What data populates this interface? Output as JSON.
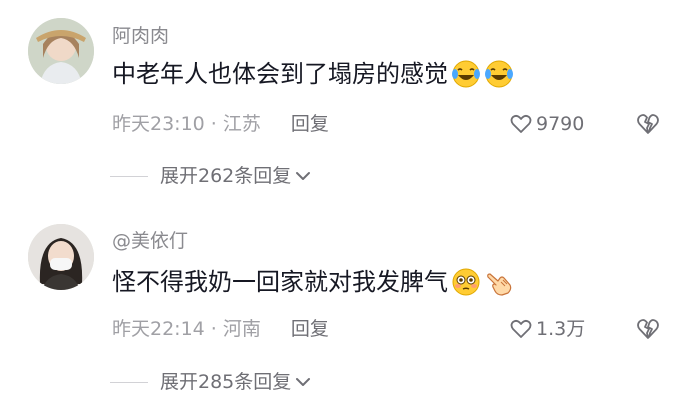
{
  "comments": [
    {
      "username": "阿肉肉",
      "text": "中老年人也体会到了塌房的感觉",
      "emojis": [
        "laugh-cry-emoji",
        "laugh-cry-emoji"
      ],
      "time": "昨天23:10",
      "location": "江苏",
      "reply_label": "回复",
      "likes": "9790",
      "expand_label": "展开262条回复"
    },
    {
      "username": "@美依仃",
      "text": "怪不得我奶一回家就对我发脾气",
      "emojis": [
        "flushed-face-emoji",
        "pointing-hand-emoji"
      ],
      "time": "昨天22:14",
      "location": "河南",
      "reply_label": "回复",
      "likes": "1.3万",
      "expand_label": "展开285条回复"
    }
  ],
  "separator": "·",
  "colors": {
    "text_primary": "#161823",
    "text_secondary": "#8a8a8f",
    "icon": "#6f6f75",
    "background": "#ffffff"
  },
  "icons": {
    "like": "heart-outline-icon",
    "dislike": "broken-heart-outline-icon",
    "expand": "chevron-down-icon"
  }
}
